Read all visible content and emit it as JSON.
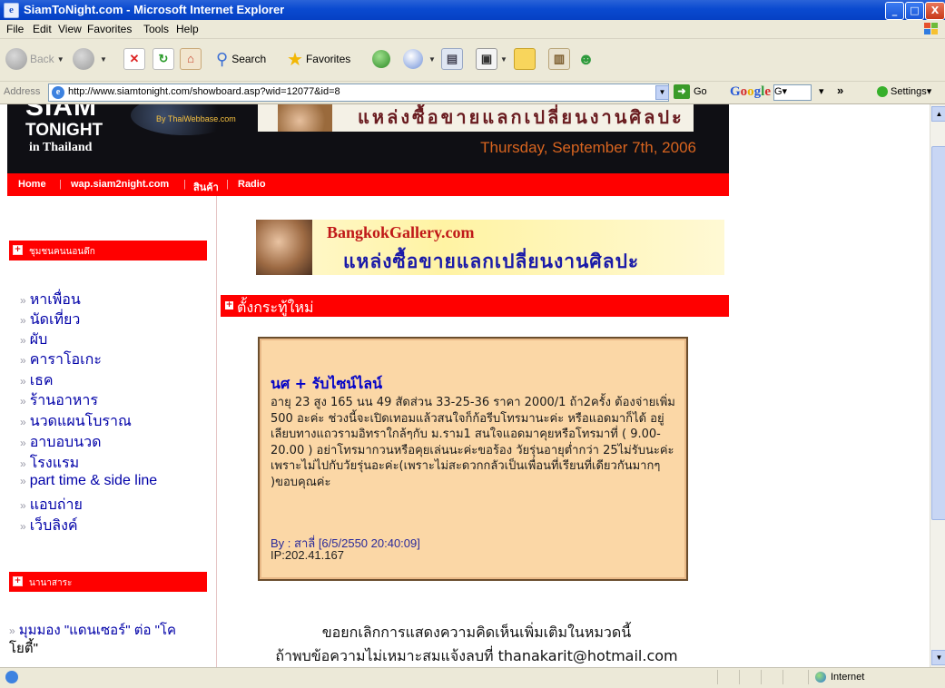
{
  "window": {
    "title": "SiamToNight.com - Microsoft Internet Explorer",
    "minimize": "_",
    "maximize": "□",
    "close": "X"
  },
  "menu": [
    "File",
    "Edit",
    "View",
    "Favorites",
    "Tools",
    "Help"
  ],
  "toolbar": {
    "back_label": "Back",
    "search_label": "Search",
    "favorites_label": "Favorites"
  },
  "address": {
    "label": "Address",
    "url": "http://www.siamtonight.com/showboard.asp?wid=12077&id=8",
    "go_label": "Go",
    "google_label": "Google",
    "google_box": "G▾",
    "more": "»",
    "settings_label": "Settings▾"
  },
  "site": {
    "logo_siam": "SIAM",
    "logo_tonight": "TONIGHT",
    "logo_thai": "in Thailand",
    "by_line": "By ThaiWebbase.com",
    "header_thai": "แหล่งซื้อขายแลกเปลี่ยนงานศิลปะ",
    "date": "Thursday, September 7th, 2006",
    "nav": [
      "Home",
      "wap.siam2night.com",
      "สินค้า",
      "Radio"
    ],
    "nav_sep": "|"
  },
  "sidebar": {
    "section1": "ชุมชนคนนอนดึก",
    "links": [
      "หาเพื่อน",
      "นัดเที่ยว",
      "ผับ",
      "คาราโอเกะ",
      "เธค",
      "ร้านอาหาร",
      "นวดแผนโบราณ",
      "อาบอบนวด",
      "โรงแรม",
      "part time & side line",
      "แอบถ่าย",
      "เว็บลิงค์"
    ],
    "section2": "นานาสาระ",
    "article_line1": "มุมมอง \"แดนเซอร์\" ต่อ \"โค",
    "article_line2": "โยตี้\""
  },
  "gallery": {
    "line1": "BangkokGallery.com",
    "line2": "แหล่งซื้อขายแลกเปลี่ยนงานศิลปะ"
  },
  "board": {
    "new_topic": "ตั้งกระทู้ใหม่"
  },
  "post": {
    "title": "นศ + รับไซน์ไลน์",
    "body": "อายุ 23 สูง 165 นน 49 สัดส่วน 33-25-36 ราคา 2000/1 ถ้า2ครั้ง ต้องจ่ายเพิ่ม 500 อะค่ะ ช่วงนี้จะเปิดเทอมแล้วสนใจก็ก้อรีบโทรมานะค่ะ หรือแอดมาก็ได้ อยู่เลียบทางแถวรามอิทราใกล้ๆกับ ม.ราม1 สนใจแอดมาคุยหรือโทรมาที่ ( 9.00-20.00 ) อย่าโทรมากวนหรือคุยเล่นนะค่ะขอร้อง วัยรุ่นอายุต่ำกว่า 25ไม่รับนะค่ะ เพราะไม่ไปกับวัยรุ่นอะค่ะ(เพราะไม่สะดวกกลัวเป็นเพื่อนที่เรียนที่เดียวกันมากๆ )ขอบคุณค่ะ",
    "by": "By : สาลี่ [6/5/2550 20:40:09]",
    "ip": "IP:202.41.167"
  },
  "notice": {
    "line1": "ขอยกเลิกการแสดงความคิดเห็นเพิ่มเติมในหมวดนี้",
    "line2": "ถ้าพบข้อความไม่เหมาะสมแจ้งลบที่ thanakarit@hotmail.com"
  },
  "status": {
    "zone": "Internet"
  }
}
